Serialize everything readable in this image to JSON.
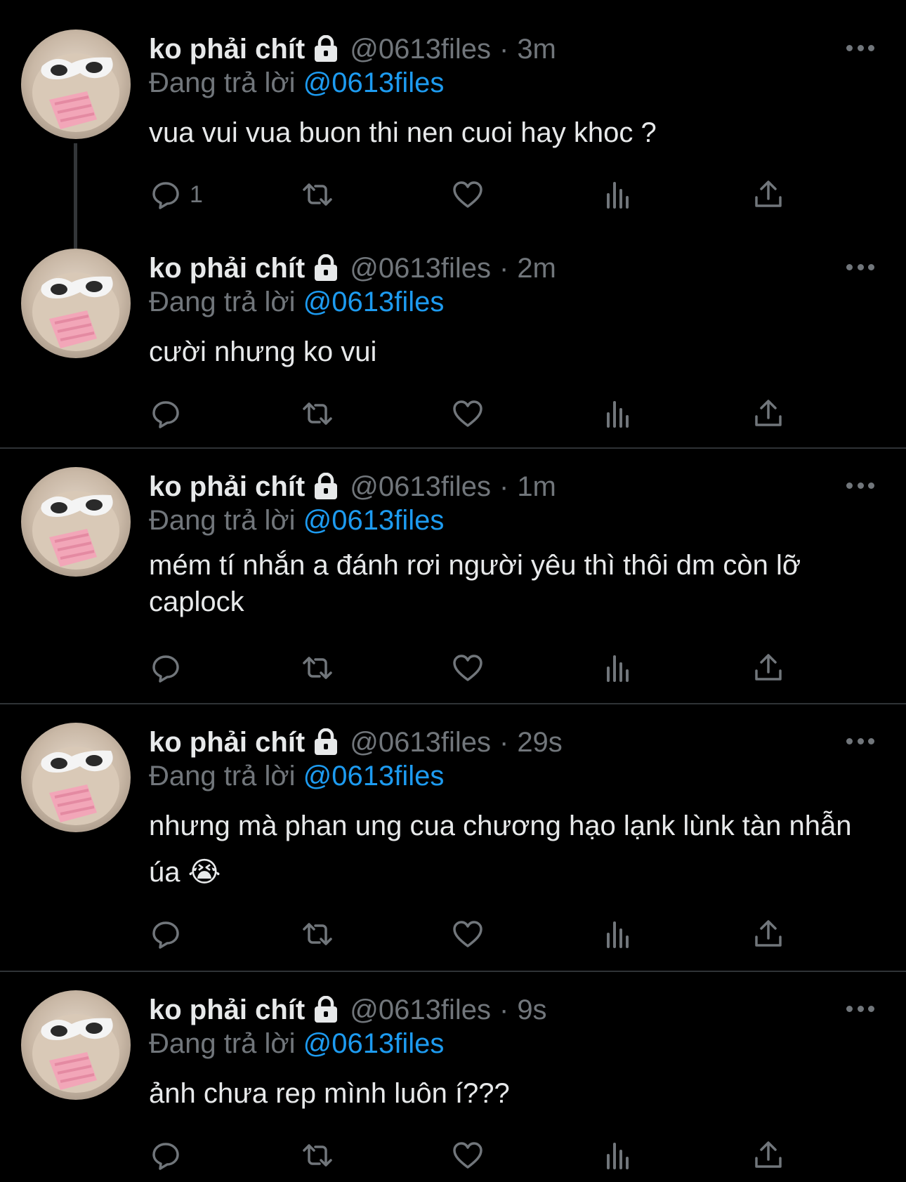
{
  "author": {
    "name": "ko phải chít",
    "handle": "@0613files"
  },
  "reply_prefix": "Đang trả lời",
  "reply_to": "@0613files",
  "tweets": [
    {
      "time": "3m",
      "text": "vua vui vua buon thi nen cuoi hay khoc ?",
      "reply_count": "1"
    },
    {
      "time": "2m",
      "text": "cười nhưng ko vui",
      "reply_count": ""
    },
    {
      "time": "1m",
      "text": "mém tí nhắn a đánh rơi người yêu thì thôi dm còn lỡ caplock",
      "reply_count": ""
    },
    {
      "time": "29s",
      "text": "nhưng mà phan ung cua chương hạo lạnk lùnk tàn nhẫn úa 😭",
      "reply_count": ""
    },
    {
      "time": "9s",
      "text": "ảnh chưa rep mình luôn í???",
      "reply_count": ""
    }
  ],
  "icons": {
    "lock": "lock-icon",
    "more": "more-icon",
    "reply": "reply-icon",
    "retweet": "retweet-icon",
    "like": "heart-icon",
    "views": "views-icon",
    "share": "share-icon"
  },
  "colors": {
    "background": "#000000",
    "text": "#e7e9ea",
    "muted": "#71767b",
    "accent": "#1d9bf0",
    "divider": "#2f3336"
  }
}
